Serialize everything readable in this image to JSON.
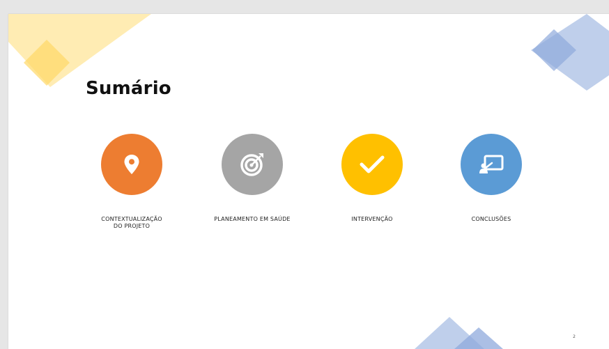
{
  "slide": {
    "title": "Sumário",
    "page_number": "2"
  },
  "items": [
    {
      "label": "CONTEXTUALIZAÇÃO\nDO PROJETO",
      "icon": "location-pin-icon",
      "color": "#ED7D31"
    },
    {
      "label": "PLANEAMENTO EM SAÚDE",
      "icon": "target-icon",
      "color": "#A5A5A5"
    },
    {
      "label": "INTERVENÇÃO",
      "icon": "checkmark-icon",
      "color": "#FFC000"
    },
    {
      "label": "CONCLUSÕES",
      "icon": "presentation-board-icon",
      "color": "#5B9BD5"
    }
  ],
  "theme": {
    "workspace_bg": "#E6E6E6",
    "slide_bg": "#FFFFFF",
    "deco_yellow": "#FFE699",
    "deco_blue": "#B4C7E7"
  }
}
